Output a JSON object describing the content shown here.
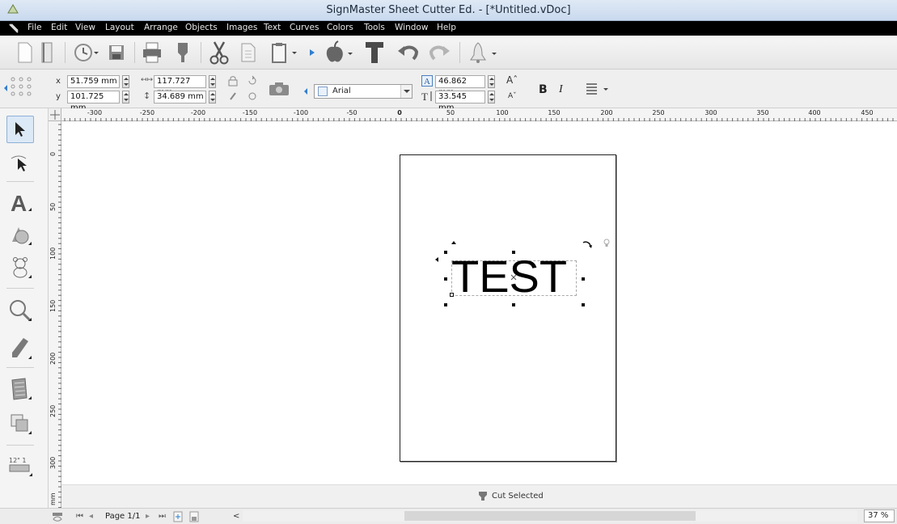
{
  "window": {
    "title": "SignMaster Sheet Cutter Ed. - [*Untitled.vDoc]"
  },
  "menu": {
    "items": [
      "File",
      "Edit",
      "View",
      "Layout",
      "Arrange",
      "Objects",
      "Images",
      "Text",
      "Curves",
      "Colors",
      "Tools",
      "Window",
      "Help"
    ]
  },
  "toolbar": {
    "buttons": [
      "new-document-icon",
      "open-icon",
      "recent-icon",
      "save-icon",
      "print-icon",
      "cutter-icon",
      "cut-icon",
      "copy-icon",
      "paste-icon",
      "import-icon",
      "apple-icon",
      "text-tool-icon",
      "undo-icon",
      "redo-icon",
      "bell-icon"
    ]
  },
  "properties": {
    "x_label": "x",
    "x_value": "51.759 mm",
    "y_label": "y",
    "y_value": "101.725 mm",
    "width_value": "117.727 mm",
    "height_value": "34.689 mm",
    "font_name": "Arial",
    "font_size": "46.862 mm",
    "text_height": "33.545 mm",
    "bold": "B",
    "italic": "I"
  },
  "ruler": {
    "h_ticks": [
      "-300",
      "-250",
      "-200",
      "-150",
      "-100",
      "-50",
      "0",
      "50",
      "100",
      "150",
      "200",
      "250",
      "300",
      "350",
      "400",
      "450"
    ],
    "v_ticks": [
      "0",
      "50",
      "100",
      "150",
      "200",
      "250",
      "300"
    ],
    "unit": "mm"
  },
  "canvas": {
    "text": "TEST"
  },
  "status": {
    "cut_selected": "Cut Selected",
    "page": "Page 1/1",
    "zoom": "37 %"
  }
}
